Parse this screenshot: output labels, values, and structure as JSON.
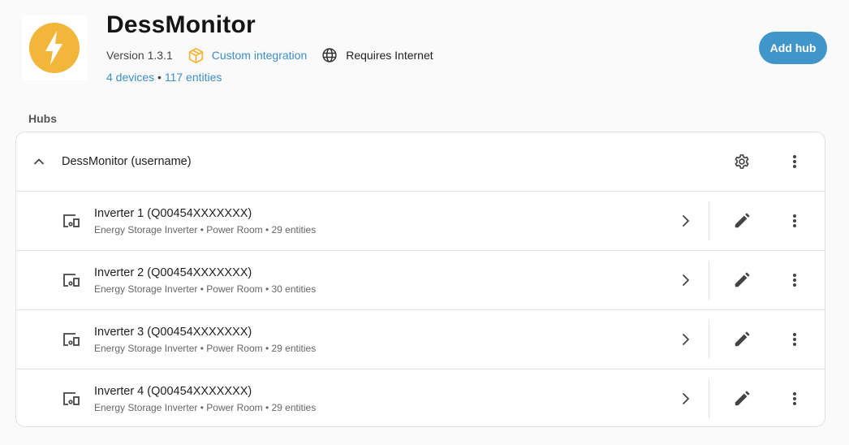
{
  "integration": {
    "title": "DessMonitor",
    "version": "Version 1.3.1",
    "custom_label": "Custom integration",
    "requires_label": "Requires Internet",
    "devices_link": "4 devices",
    "separator": " • ",
    "entities_link": "117 entities",
    "add_button": "Add hub",
    "accent_color": "#4196c9",
    "logo_color": "#f2b63a",
    "logo_icon": "lightning-bolt-icon"
  },
  "hubs_section": {
    "label": "Hubs",
    "hub": {
      "name": "DessMonitor (username)",
      "expanded": true
    },
    "devices": [
      {
        "name": "Inverter 1 (Q00454XXXXXXX)",
        "subtitle": "Energy Storage Inverter • Power Room • 29 entities"
      },
      {
        "name": "Inverter 2 (Q00454XXXXXXX)",
        "subtitle": "Energy Storage Inverter • Power Room • 30 entities"
      },
      {
        "name": "Inverter 3 (Q00454XXXXXXX)",
        "subtitle": "Energy Storage Inverter • Power Room • 29 entities"
      },
      {
        "name": "Inverter 4 (Q00454XXXXXXX)",
        "subtitle": "Energy Storage Inverter • Power Room • 29 entities"
      }
    ]
  }
}
